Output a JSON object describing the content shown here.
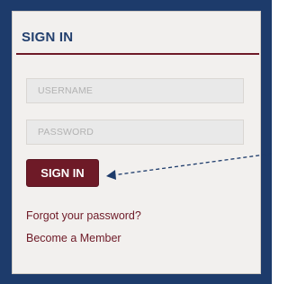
{
  "signin_panel": {
    "heading": "SIGN IN",
    "username": {
      "placeholder": "USERNAME",
      "value": ""
    },
    "password": {
      "placeholder": "PASSWORD",
      "value": ""
    },
    "signin_button_label": "SIGN IN",
    "forgot_password_link": "Forgot your password?",
    "become_member_link": "Become a Member"
  },
  "colors": {
    "frame": "#1d3b6b",
    "panel": "#f2f0ee",
    "heading": "#23406e",
    "accent": "#6e1a27",
    "annotation_arrow": "#1d3b6b"
  },
  "icons": {
    "annotation": "dashed-arrow-icon"
  }
}
